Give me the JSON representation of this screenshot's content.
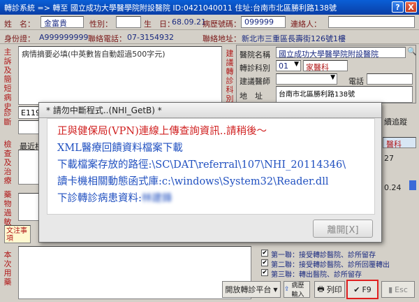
{
  "titlebar": {
    "text": "轉診系統 => 轉至 國立成功大學醫學院附設醫院 ID:0421040011 住址:台南市北區勝利路138號",
    "help": "?",
    "close": "X"
  },
  "patient": {
    "name_label": "姓　名：",
    "name_value": "金富貴",
    "sex_label": "性別：",
    "birth_label": "生　日：",
    "birth_value": "68.09.21",
    "chart_label": "病歷號碼：",
    "chart_value": "099999",
    "contact_label": "連絡人：",
    "id_label": "身份證：",
    "id_value": "A999999999",
    "phone_label": "聯絡電話：",
    "phone_value": "07-3154932",
    "addr_label": "聯絡地址：",
    "addr_value": "新北市三重區長壽街126號1樓"
  },
  "left_labels": {
    "complaint": "主訴及簡短病史",
    "diagnosis": "診斷",
    "exam": "檢查及治療",
    "meds": "藥物過敏",
    "notes": "本次用藥"
  },
  "complaint_text": "病情摘要必填(中英數皆自動超過500字元)",
  "diag_code": "E119",
  "suggest_label": "建議轉診科別",
  "hospital": {
    "name_label": "醫院名稱",
    "name_value": "國立成功大學醫學院附設醫院",
    "dept_label": "轉診科別",
    "dept_value": "01",
    "dept_name": "家醫科",
    "doctor_label": "建議醫師",
    "tel_label": "電話",
    "addr_label": "地　址",
    "addr_value": "台南市北區勝利路138號"
  },
  "exam_recent": "最近相",
  "side_frag": {
    "track": "續追蹤",
    "dept": "醫科",
    "num1": "27",
    "num2": "0.24"
  },
  "memo_label": "文注事項",
  "dialog": {
    "title": "* 請勿中斷程式..(NHI_GetB) *",
    "line1": "正與健保局(VPN)連線上傳查詢資訊..請稍後～",
    "line2": "XML醫療回饋資料檔案下載",
    "line3": "下載檔案存放的路徑:\\SC\\DAT\\referral\\107\\NHI_20114346\\",
    "line4": "讀卡機相關動態函式庫:c:\\windows\\System32\\Reader.dll",
    "line5": "下診轉診病患資料:",
    "line5_name": "林建鋒",
    "close_btn": "離開[X]"
  },
  "checks": [
    {
      "label": "第一聯：接受轉診醫院、診所留存",
      "checked": true
    },
    {
      "label": "第二聯：接受轉診醫院、診所回覆轉出",
      "checked": true
    },
    {
      "label": "第三聯：轉出醫院、診所留存",
      "checked": true
    }
  ],
  "buttons": {
    "platform": "開放轉診平台",
    "nhi_upload": "病歷輸入",
    "print": "列印",
    "f9": "F9",
    "esc": "Esc"
  },
  "colors": {
    "title_blue": "#0a4fc4",
    "label_red": "#b01818",
    "value_blue": "#1a2a80",
    "highlight": "#e02020"
  }
}
